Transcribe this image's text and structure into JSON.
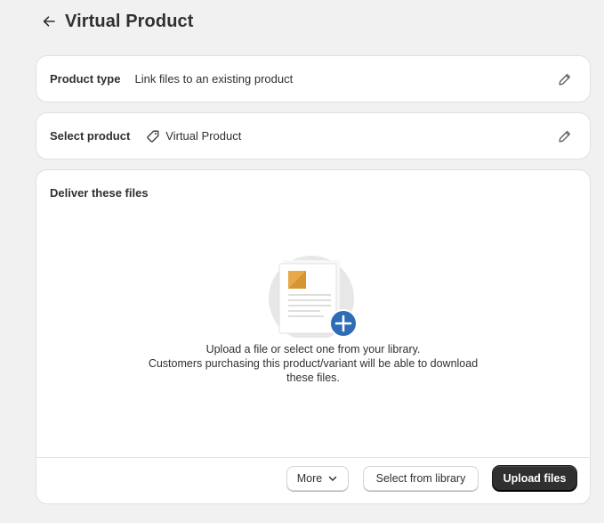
{
  "header": {
    "title": "Virtual Product",
    "back_icon": "arrow-left-icon"
  },
  "product_type": {
    "label": "Product type",
    "value": "Link files to an existing product",
    "edit_icon": "pencil-icon"
  },
  "select_product": {
    "label": "Select product",
    "value": "Virtual Product",
    "value_icon": "tag-icon",
    "edit_icon": "pencil-icon"
  },
  "deliver": {
    "title": "Deliver these files",
    "illustration_icon": "file-upload-illustration",
    "empty_line1": "Upload a file or select one from your library.",
    "empty_line2": "Customers purchasing this product/variant will be able to download these files.",
    "buttons": {
      "more": "More",
      "select_from_library": "Select from library",
      "upload": "Upload files"
    }
  },
  "colors": {
    "background": "#f1f1f1",
    "card": "#ffffff",
    "primary_button": "#303030",
    "plus_badge": "#2e6cb5",
    "file_thumb": "#e7a949"
  }
}
